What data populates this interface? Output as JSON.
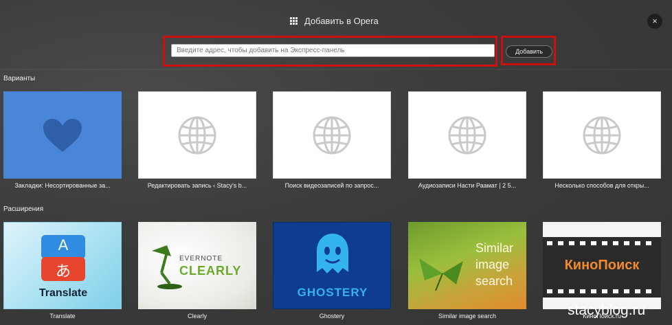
{
  "dialog": {
    "title": "Добавить в Opera",
    "close_label": "×"
  },
  "url_input": {
    "placeholder": "Введите адрес, чтобы добавить на Экспресс-панель",
    "value": ""
  },
  "add_button": {
    "label": "Добавить"
  },
  "sections": {
    "variants": {
      "label": "Варианты",
      "items": [
        {
          "caption": "Закладки: Несортированные за...",
          "icon": "heart-icon"
        },
        {
          "caption": "Редактировать запись ‹ Stacy's b...",
          "icon": "globe-icon"
        },
        {
          "caption": "Поиск видеозаписей по запрос...",
          "icon": "globe-icon"
        },
        {
          "caption": "Аудиозаписи Насти Раамат | 2 5...",
          "icon": "globe-icon"
        },
        {
          "caption": "Несколько способов для откры...",
          "icon": "globe-icon"
        }
      ]
    },
    "extensions": {
      "label": "Расширения",
      "items": [
        {
          "caption": "Translate",
          "tile_text": "Translate",
          "glyph_a": "A",
          "glyph_b": "あ"
        },
        {
          "caption": "Clearly",
          "tile_line1": "EVERNOTE",
          "tile_line2": "CLEARLY"
        },
        {
          "caption": "Ghostery",
          "tile_text": "GHOSTERY"
        },
        {
          "caption": "Similar image search",
          "tile_line1": "Similar",
          "tile_line2": "image",
          "tile_line3": "search"
        },
        {
          "caption": "КиноПоиск.ru",
          "tile_text": "КиноПоиск"
        }
      ]
    }
  },
  "watermark": "stacyblog.ru",
  "colors": {
    "highlight_border": "#cc1010",
    "variant_blue": "#4a86d8",
    "heart": "#2f5fa8",
    "ghost_bg": "#0e3c8f"
  }
}
